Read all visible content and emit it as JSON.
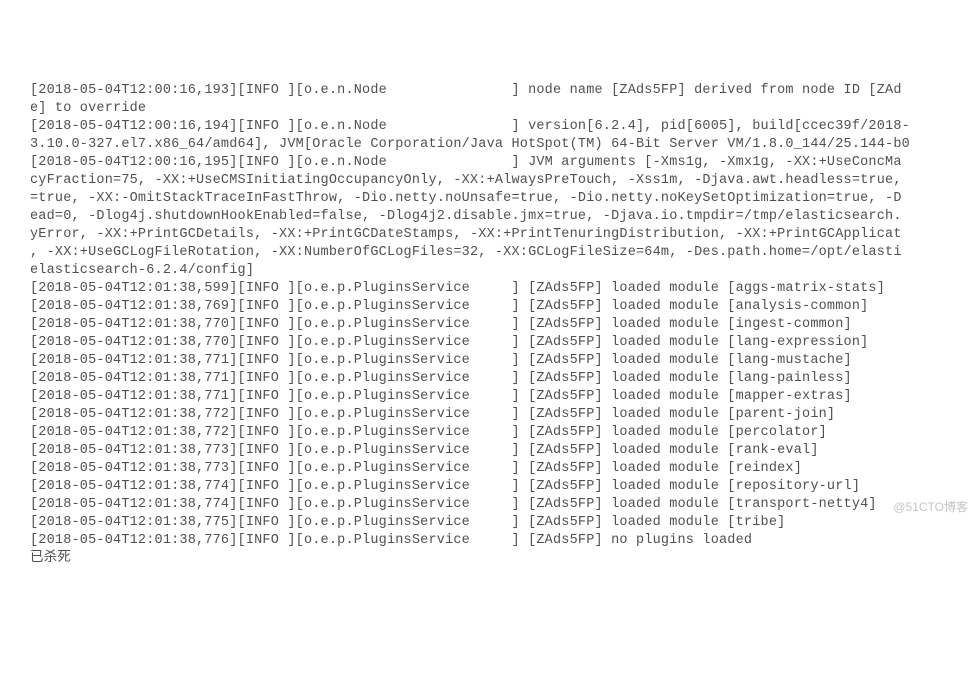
{
  "log_lines": [
    "[2018-05-04T12:00:16,193][INFO ][o.e.n.Node               ] node name [ZAds5FP] derived from node ID [ZAd",
    "e] to override",
    "[2018-05-04T12:00:16,194][INFO ][o.e.n.Node               ] version[6.2.4], pid[6005], build[ccec39f/2018-",
    "3.10.0-327.el7.x86_64/amd64], JVM[Oracle Corporation/Java HotSpot(TM) 64-Bit Server VM/1.8.0_144/25.144-b0",
    "[2018-05-04T12:00:16,195][INFO ][o.e.n.Node               ] JVM arguments [-Xms1g, -Xmx1g, -XX:+UseConcMa",
    "cyFraction=75, -XX:+UseCMSInitiatingOccupancyOnly, -XX:+AlwaysPreTouch, -Xss1m, -Djava.awt.headless=true,",
    "=true, -XX:-OmitStackTraceInFastThrow, -Dio.netty.noUnsafe=true, -Dio.netty.noKeySetOptimization=true, -D",
    "ead=0, -Dlog4j.shutdownHookEnabled=false, -Dlog4j2.disable.jmx=true, -Djava.io.tmpdir=/tmp/elasticsearch.",
    "yError, -XX:+PrintGCDetails, -XX:+PrintGCDateStamps, -XX:+PrintTenuringDistribution, -XX:+PrintGCApplicat",
    ", -XX:+UseGCLogFileRotation, -XX:NumberOfGCLogFiles=32, -XX:GCLogFileSize=64m, -Des.path.home=/opt/elasti",
    "elasticsearch-6.2.4/config]",
    "[2018-05-04T12:01:38,599][INFO ][o.e.p.PluginsService     ] [ZAds5FP] loaded module [aggs-matrix-stats]",
    "[2018-05-04T12:01:38,769][INFO ][o.e.p.PluginsService     ] [ZAds5FP] loaded module [analysis-common]",
    "[2018-05-04T12:01:38,770][INFO ][o.e.p.PluginsService     ] [ZAds5FP] loaded module [ingest-common]",
    "[2018-05-04T12:01:38,770][INFO ][o.e.p.PluginsService     ] [ZAds5FP] loaded module [lang-expression]",
    "[2018-05-04T12:01:38,771][INFO ][o.e.p.PluginsService     ] [ZAds5FP] loaded module [lang-mustache]",
    "[2018-05-04T12:01:38,771][INFO ][o.e.p.PluginsService     ] [ZAds5FP] loaded module [lang-painless]",
    "[2018-05-04T12:01:38,771][INFO ][o.e.p.PluginsService     ] [ZAds5FP] loaded module [mapper-extras]",
    "[2018-05-04T12:01:38,772][INFO ][o.e.p.PluginsService     ] [ZAds5FP] loaded module [parent-join]",
    "[2018-05-04T12:01:38,772][INFO ][o.e.p.PluginsService     ] [ZAds5FP] loaded module [percolator]",
    "[2018-05-04T12:01:38,773][INFO ][o.e.p.PluginsService     ] [ZAds5FP] loaded module [rank-eval]",
    "[2018-05-04T12:01:38,773][INFO ][o.e.p.PluginsService     ] [ZAds5FP] loaded module [reindex]",
    "[2018-05-04T12:01:38,774][INFO ][o.e.p.PluginsService     ] [ZAds5FP] loaded module [repository-url]",
    "[2018-05-04T12:01:38,774][INFO ][o.e.p.PluginsService     ] [ZAds5FP] loaded module [transport-netty4]",
    "[2018-05-04T12:01:38,775][INFO ][o.e.p.PluginsService     ] [ZAds5FP] loaded module [tribe]",
    "[2018-05-04T12:01:38,776][INFO ][o.e.p.PluginsService     ] [ZAds5FP] no plugins loaded",
    "已杀死"
  ],
  "watermark": "@51CTO博客"
}
